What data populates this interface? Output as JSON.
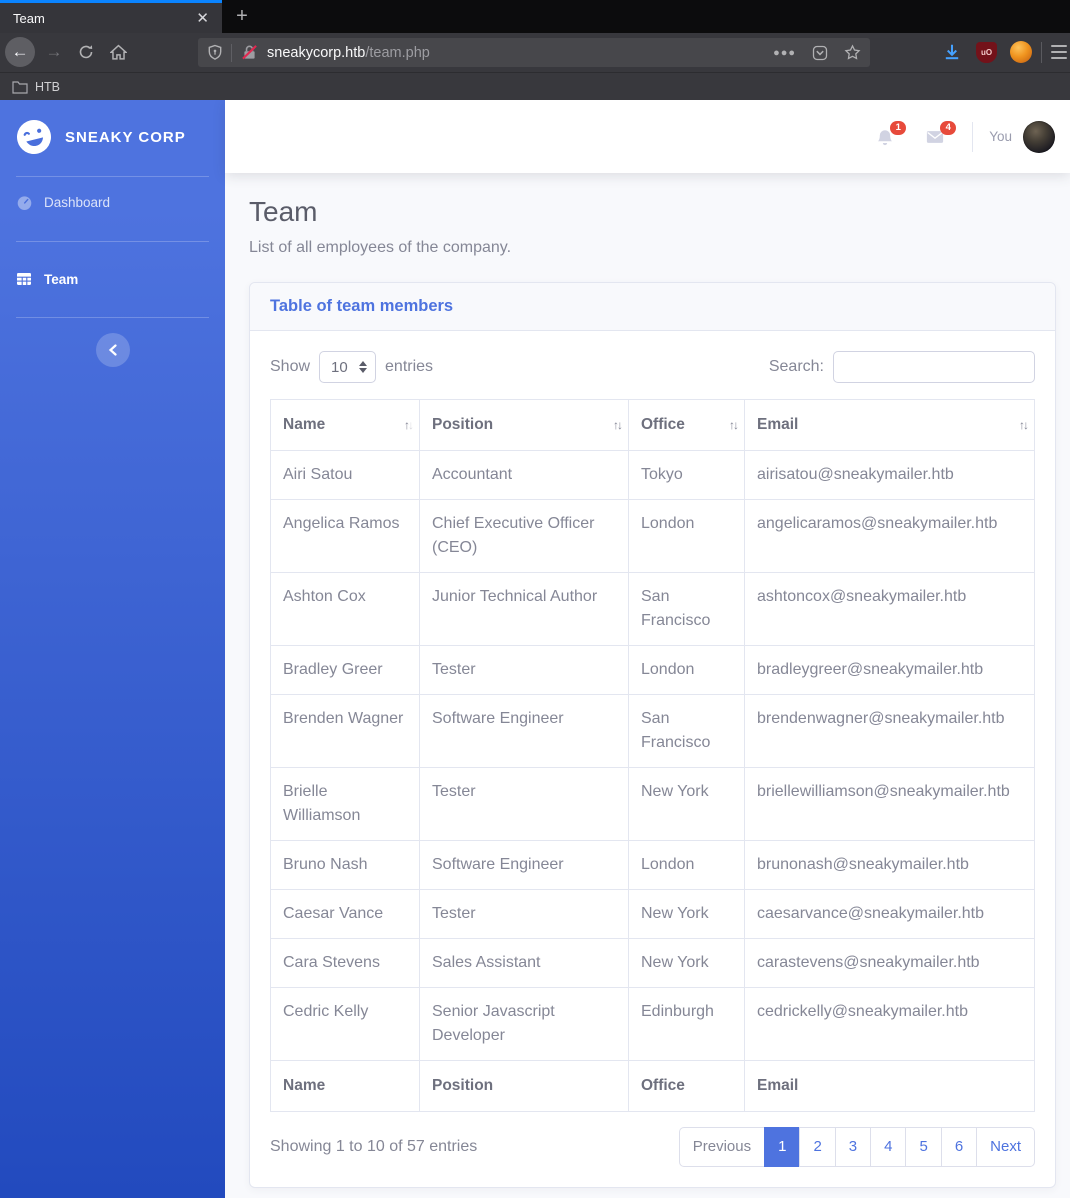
{
  "browser": {
    "tab": {
      "title": "Team"
    },
    "toolbar": {
      "url_host": "sneakycorp.htb",
      "url_path": "/team.php"
    },
    "bookmarks": {
      "folder_label": "HTB"
    },
    "extensions": {
      "ublock_label": "uO"
    }
  },
  "sidebar": {
    "brand": "SNEAKY CORP",
    "items": [
      {
        "label": "Dashboard",
        "active": false
      },
      {
        "label": "Team",
        "active": true
      }
    ]
  },
  "topbar": {
    "alerts_badge": "1",
    "messages_badge": "4",
    "user_label": "You"
  },
  "page": {
    "title": "Team",
    "subtitle": "List of all employees of the company."
  },
  "card": {
    "header": "Table of team members",
    "length_label_before": "Show",
    "length_value": "10",
    "length_label_after": "entries",
    "search_label": "Search:",
    "search_value": "",
    "info": "Showing 1 to 10 of 57 entries"
  },
  "table": {
    "columns": [
      "Name",
      "Position",
      "Office",
      "Email"
    ],
    "sort": {
      "column": "Name",
      "direction": "asc"
    },
    "rows": [
      [
        "Airi Satou",
        "Accountant",
        "Tokyo",
        "airisatou@sneakymailer.htb"
      ],
      [
        "Angelica Ramos",
        "Chief Executive Officer (CEO)",
        "London",
        "angelicaramos@sneakymailer.htb"
      ],
      [
        "Ashton Cox",
        "Junior Technical Author",
        "San Francisco",
        "ashtoncox@sneakymailer.htb"
      ],
      [
        "Bradley Greer",
        "Tester",
        "London",
        "bradleygreer@sneakymailer.htb"
      ],
      [
        "Brenden Wagner",
        "Software Engineer",
        "San Francisco",
        "brendenwagner@sneakymailer.htb"
      ],
      [
        "Brielle Williamson",
        "Tester",
        "New York",
        "briellewilliamson@sneakymailer.htb"
      ],
      [
        "Bruno Nash",
        "Software Engineer",
        "London",
        "brunonash@sneakymailer.htb"
      ],
      [
        "Caesar Vance",
        "Tester",
        "New York",
        "caesarvance@sneakymailer.htb"
      ],
      [
        "Cara Stevens",
        "Sales Assistant",
        "New York",
        "carastevens@sneakymailer.htb"
      ],
      [
        "Cedric Kelly",
        "Senior Javascript Developer",
        "Edinburgh",
        "cedrickelly@sneakymailer.htb"
      ]
    ]
  },
  "pagination": {
    "previous": "Previous",
    "pages": [
      "1",
      "2",
      "3",
      "4",
      "5",
      "6"
    ],
    "active_page": "1",
    "next": "Next"
  },
  "colors": {
    "accent": "#4e73df",
    "sidebar_gradient_start": "#4e73df",
    "sidebar_gradient_end": "#224abe",
    "badge_red": "#e74a3b",
    "text_muted": "#858796",
    "border": "#e3e6f0",
    "tab_accent": "#0a84ff"
  }
}
